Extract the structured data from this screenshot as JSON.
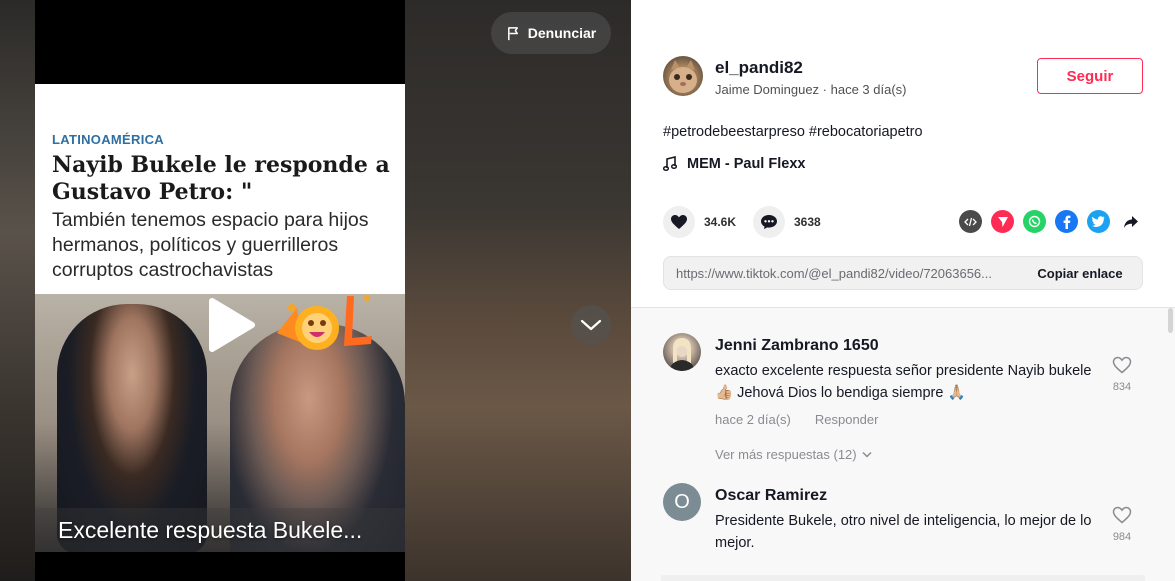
{
  "video": {
    "report_label": "Denunciar",
    "overlay": {
      "category": "LATINOAMÉRICA",
      "headline": "Nayib Bukele le responde a Gustavo Petro: \"",
      "subhead": "También tenemos espacio para hijos hermanos, políticos y guerrilleros corruptos castrochavistas"
    },
    "caption": "Excelente respuesta Bukele..."
  },
  "author": {
    "username": "el_pandi82",
    "display_name": "Jaime Dominguez",
    "separator": " · ",
    "posted": "hace 3 día(s)",
    "follow_label": "Seguir"
  },
  "post": {
    "hashtags": "#petrodebeestarpreso #rebocatoriapetro",
    "music": "MEM - Paul Flexx"
  },
  "actions": {
    "likes": "34.6K",
    "comments": "3638"
  },
  "share": {
    "url": "https://www.tiktok.com/@el_pandi82/video/72063656...",
    "copy_label": "Copiar enlace",
    "icons": [
      "embed-icon",
      "send-icon",
      "whatsapp-icon",
      "facebook-icon",
      "twitter-icon",
      "share-arrow-icon"
    ]
  },
  "comments": [
    {
      "name": "Jenni Zambrano 1650",
      "text": "exacto excelente respuesta señor presidente Nayib bukele 👍🏼 Jehová Dios lo bendiga siempre 🙏🏼",
      "time": "hace 2 día(s)",
      "reply_label": "Responder",
      "likes": "834",
      "more_replies": "Ver más respuestas (12)"
    },
    {
      "name": "Oscar Ramirez",
      "avatar_letter": "O",
      "text": "Presidente Bukele, otro nivel de inteligencia, lo mejor de lo mejor.",
      "likes": "984"
    }
  ],
  "colors": {
    "accent": "#fe2c55",
    "whatsapp": "#25d366",
    "facebook": "#1877f2",
    "twitter": "#1da1f2",
    "embed": "#4a4a4a"
  }
}
